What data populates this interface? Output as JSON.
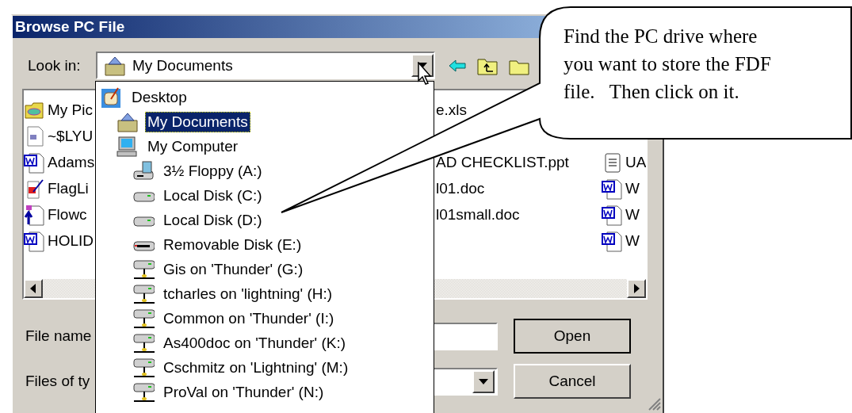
{
  "window": {
    "title": "Browse PC File"
  },
  "look_in": {
    "label": "Look in:",
    "value": "My Documents"
  },
  "file_list": {
    "columns": [
      [
        {
          "name": "My Pic",
          "kind": "pictures-folder"
        },
        {
          "name": "~$LYU",
          "kind": "temp-file"
        },
        {
          "name": "Adams",
          "kind": "word"
        },
        {
          "name": "FlagLi",
          "kind": "flag-doc"
        },
        {
          "name": "Flowc",
          "kind": "flowchart"
        },
        {
          "name": "HOLID",
          "kind": "word"
        }
      ],
      [
        {
          "name": "e.xls",
          "kind": "text-only"
        },
        {
          "kind": "blank"
        },
        {
          "name": "AD CHECKLIST.ppt",
          "kind": "text-only"
        },
        {
          "name": "l01.doc",
          "kind": "text-only"
        },
        {
          "name": "l01small.doc",
          "kind": "text-only"
        },
        {
          "kind": "blank"
        }
      ],
      [
        {
          "kind": "blank"
        },
        {
          "kind": "blank"
        },
        {
          "name": "UA",
          "kind": "notepad"
        },
        {
          "name": "W",
          "kind": "word"
        },
        {
          "name": "W",
          "kind": "word"
        },
        {
          "name": "W",
          "kind": "word"
        }
      ]
    ]
  },
  "location_dropdown": {
    "items": [
      {
        "label": "Desktop",
        "kind": "desktop",
        "selected": false,
        "children": [
          {
            "label": "My Documents",
            "kind": "documents",
            "selected": true
          },
          {
            "label": "My Computer",
            "kind": "computer",
            "selected": false,
            "children": [
              {
                "label": "3½ Floppy (A:)",
                "kind": "floppy",
                "selected": false
              },
              {
                "label": "Local Disk (C:)",
                "kind": "disk",
                "selected": false
              },
              {
                "label": "Local Disk (D:)",
                "kind": "disk",
                "selected": false
              },
              {
                "label": "Removable Disk (E:)",
                "kind": "removable",
                "selected": false
              },
              {
                "label": "Gis on 'Thunder' (G:)",
                "kind": "network",
                "selected": false
              },
              {
                "label": "tcharles on 'lightning' (H:)",
                "kind": "network",
                "selected": false
              },
              {
                "label": "Common on 'Thunder' (I:)",
                "kind": "network",
                "selected": false
              },
              {
                "label": "As400doc on 'Thunder' (K:)",
                "kind": "network",
                "selected": false
              },
              {
                "label": "Cschmitz on 'Lightning' (M:)",
                "kind": "network",
                "selected": false
              },
              {
                "label": "ProVal on 'Thunder' (N:)",
                "kind": "network",
                "selected": false
              }
            ]
          }
        ]
      }
    ]
  },
  "file_name": {
    "label": "File name"
  },
  "files_of_type": {
    "label": "Files of ty"
  },
  "buttons": [
    {
      "label": "Open",
      "default": true
    },
    {
      "label": "Cancel",
      "default": false
    }
  ],
  "callout": {
    "text": "Find the PC drive where\nyou want to store the FDF\nfile.   Then click on it."
  }
}
